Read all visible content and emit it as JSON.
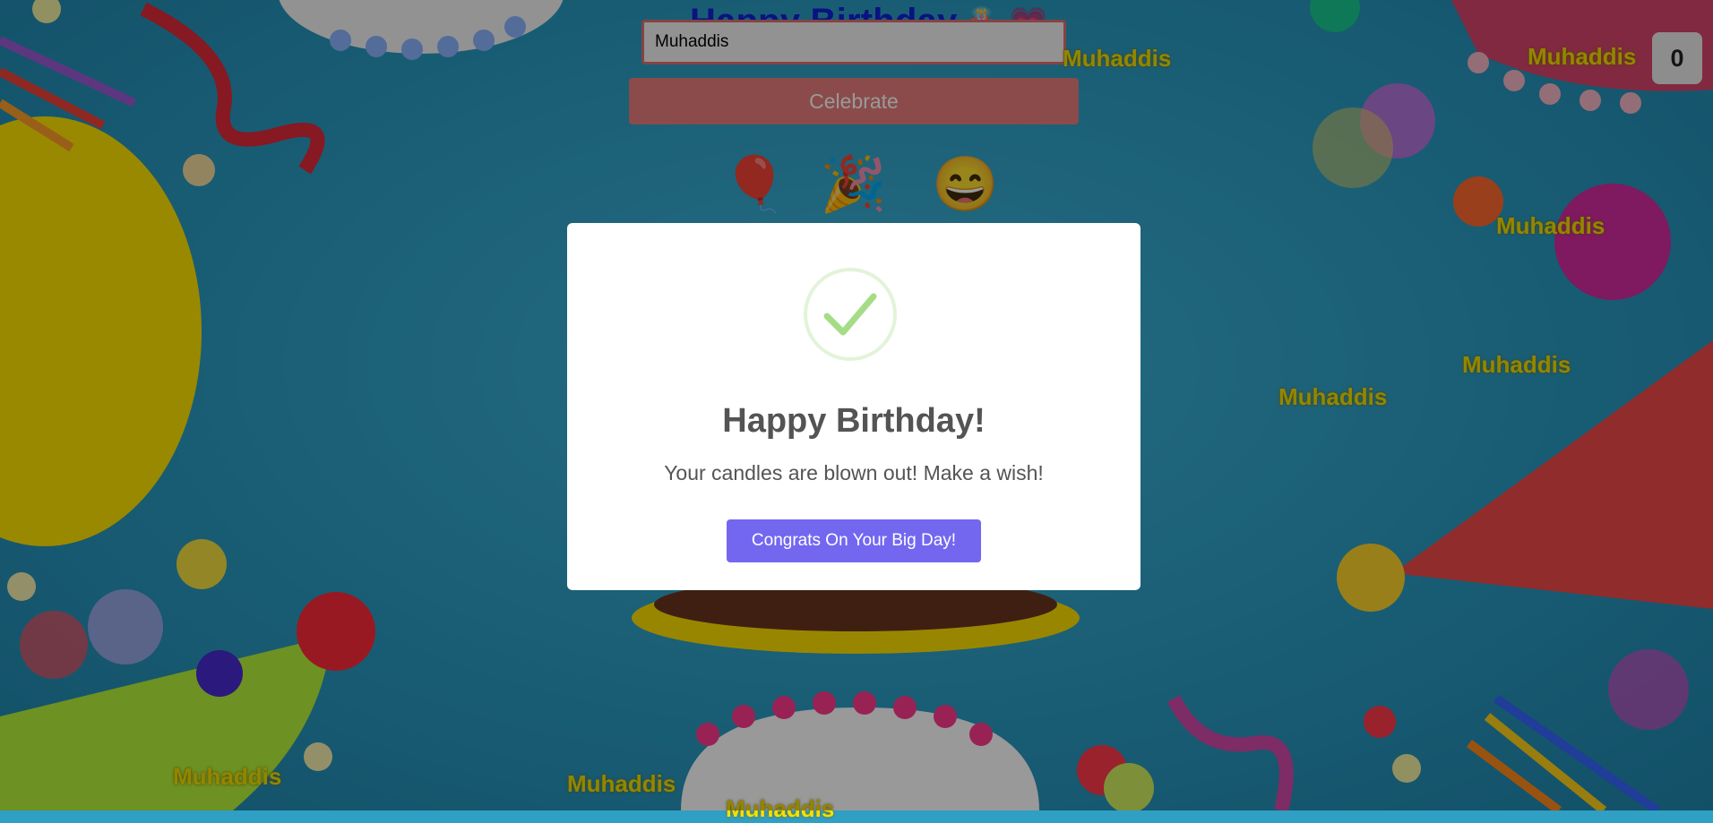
{
  "header": {
    "title": "Happy Birthday",
    "title_emoji": "🎂 💗"
  },
  "form": {
    "name_value": "Muhaddis",
    "celebrate_label": "Celebrate"
  },
  "counter": {
    "value": "0"
  },
  "emojis": [
    "🎈",
    "🎉",
    "😄"
  ],
  "floating_names": [
    "Muhaddis",
    "Muhaddis",
    "Muhaddis",
    "Muhaddis",
    "Muhaddis",
    "Muhaddis",
    "Muhaddis",
    "Muhaddis"
  ],
  "modal": {
    "icon": "checkmark-icon",
    "title": "Happy Birthday!",
    "text": "Your candles are blown out! Make a wish!",
    "confirm_label": "Congrats On Your Big Day!"
  },
  "colors": {
    "title": "#1020d8",
    "celebrate": "#e87d7d",
    "confirm": "#7367f0",
    "name_tag": "#f5e000",
    "background": "#2f9fc4"
  }
}
